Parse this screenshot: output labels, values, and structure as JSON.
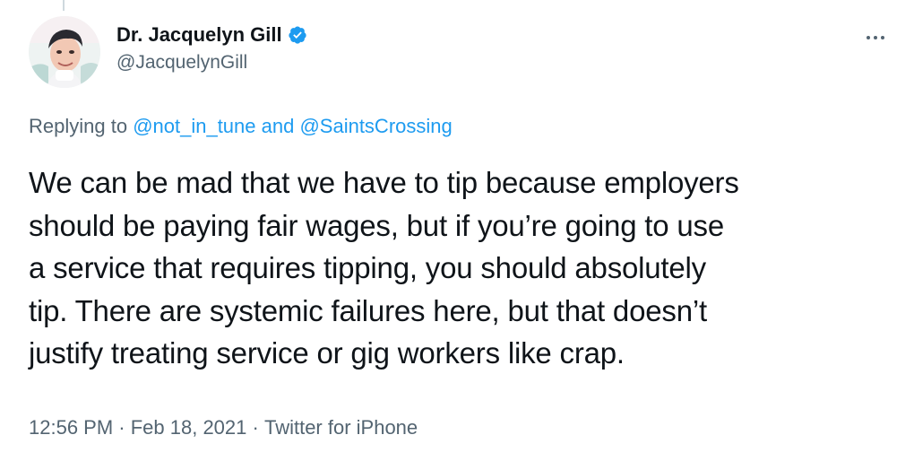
{
  "author": {
    "display_name": "Dr. Jacquelyn Gill",
    "handle": "@JacquelynGill",
    "verified": true,
    "avatar_icon": "user-avatar-photo"
  },
  "reply": {
    "prefix": "Replying to ",
    "mention_1": "@not_in_tune",
    "joiner": " and ",
    "mention_2": "@SaintsCrossing"
  },
  "tweet": {
    "text_lines": [
      "We can be mad that we have to tip because employers",
      "should be paying fair wages, but if you’re going to use",
      "a service that requires tipping, you should absolutely",
      "tip. There are systemic failures here, but that doesn’t",
      "justify treating service or gig workers like crap."
    ]
  },
  "meta": {
    "time": "12:56 PM",
    "separator": " · ",
    "date": "Feb 18, 2021",
    "separator_2": " · ",
    "source": "Twitter for iPhone"
  },
  "colors": {
    "accent": "#1d9bf0",
    "text_primary": "#0f1419",
    "text_secondary": "#536471"
  },
  "icons": {
    "verified": "verified-badge-icon",
    "more": "more-options-icon"
  }
}
